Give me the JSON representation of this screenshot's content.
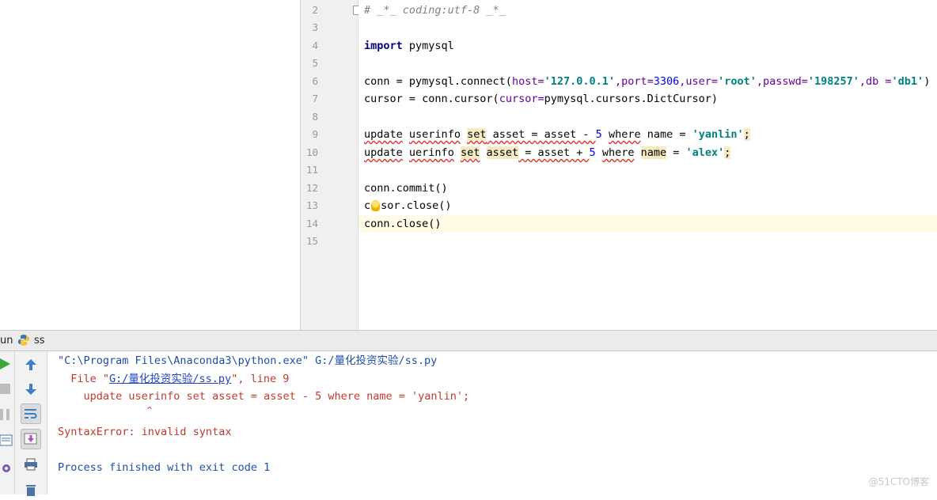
{
  "editor": {
    "line_numbers": [
      "2",
      "3",
      "4",
      "5",
      "6",
      "7",
      "8",
      "9",
      "10",
      "11",
      "12",
      "13",
      "14",
      "15"
    ],
    "lines": {
      "l2": "# _*_ coding:utf-8 _*_",
      "l4_kw": "import",
      "l4_rest": " pymysql",
      "l6_a": "conn = pymysql.connect(",
      "l6_host": "host=",
      "l6_hostv": "'127.0.0.1'",
      "l6_port": ",port=",
      "l6_portv": "3306",
      "l6_user": ",user=",
      "l6_userv": "'root'",
      "l6_pw": ",passwd=",
      "l6_pwv": "'198257'",
      "l6_db": ",db =",
      "l6_dbv": "'db1'",
      "l6_end": ")",
      "l7_a": "cursor = conn.cursor(",
      "l7_p": "cursor=",
      "l7_b": "pymysql.cursors.DictCursor)",
      "l9_update": "update",
      "l9_sp": " ",
      "l9_userinfo": "userinfo",
      "l9_set": "set",
      "l9_mid": " asset = asset - ",
      "l9_num": "5",
      "l9_where": "where",
      "l9_name": " name = ",
      "l9_str": "'yanlin'",
      "l9_semi": ";",
      "l10_update": "update",
      "l10_uerinfo": "uerinfo",
      "l10_set": "set",
      "l10_asset": "asset",
      "l10_mid": " = asset + ",
      "l10_num": "5",
      "l10_where": "where",
      "l10_name": "name",
      "l10_eq": " = ",
      "l10_str": "'alex'",
      "l10_semi": ";",
      "l12": "conn.commit()",
      "l13_a": "c",
      "l13_b": "sor.close()",
      "l14": "conn.close()"
    }
  },
  "run_bar": {
    "label": "un",
    "config_name": "ss"
  },
  "console": {
    "cmd_q1": "\"C:\\Program Files\\Anaconda3\\python.exe\"",
    "cmd_rest": " G:/量化投资实验/ss.py",
    "file_prefix": "  File \"",
    "file_link": "G:/量化投资实验/ss.py",
    "file_suffix": "\", line 9",
    "code_line": "    update userinfo set asset = asset - 5 where name = 'yanlin';",
    "caret": "                 ^",
    "error": "SyntaxError: invalid syntax",
    "finished": "Process finished with exit code 1"
  },
  "watermark": "@51CTO博客",
  "colors": {
    "keyword": "#000080",
    "string": "#008080",
    "number": "#0000ff",
    "error_red": "#c0392b",
    "console_blue": "#1d4fa8"
  }
}
